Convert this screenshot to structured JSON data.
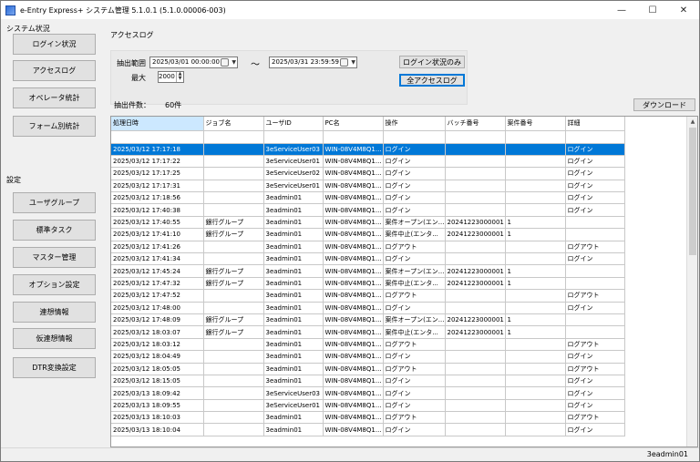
{
  "window": {
    "title": "e-Entry Express+ システム管理 5.1.0.1 (5.1.0.00006-003)",
    "controls": [
      "—",
      "☐",
      "✕"
    ]
  },
  "sidebar": {
    "system_status_label": "システム状況",
    "system_items": [
      {
        "label": "ログイン状況"
      },
      {
        "label": "アクセスログ"
      },
      {
        "label": "オペレータ統計"
      },
      {
        "label": "フォーム別統計"
      }
    ],
    "settings_label": "設定",
    "settings_items": [
      {
        "label": "ユーザグループ"
      },
      {
        "label": "標準タスク"
      },
      {
        "label": "マスター管理"
      },
      {
        "label": "オプション設定"
      },
      {
        "label": "連想情報"
      },
      {
        "label": "仮連想情報"
      },
      {
        "label": "DTR変換設定"
      }
    ]
  },
  "main": {
    "group_label": "アクセスログ",
    "filter": {
      "range_label": "抽出範囲",
      "from": "2025/03/01 00:00:00",
      "tilde": "～",
      "to": "2025/03/31 23:59:59",
      "max_label": "最大",
      "max_value": "2000",
      "login_only_button": "ログイン状況のみ",
      "all_logs_button": "全アクセスログ"
    },
    "count_label": "抽出件数：",
    "count_value": "60件",
    "download_button": "ダウンロード",
    "table": {
      "columns": [
        "処理日時",
        "ジョブ名",
        "ユーザID",
        "PC名",
        "操作",
        "バッチ番号",
        "案件番号",
        "詳細"
      ],
      "rows": [
        [
          "2025/03/12 17:17:18",
          "",
          "3eServiceUser03",
          "WIN-08V4M8Q1...",
          "ログイン",
          "",
          "",
          "ログイン"
        ],
        [
          "2025/03/12 17:17:22",
          "",
          "3eServiceUser01",
          "WIN-08V4M8Q1...",
          "ログイン",
          "",
          "",
          "ログイン"
        ],
        [
          "2025/03/12 17:17:25",
          "",
          "3eServiceUser02",
          "WIN-08V4M8Q1...",
          "ログイン",
          "",
          "",
          "ログイン"
        ],
        [
          "2025/03/12 17:17:31",
          "",
          "3eServiceUser01",
          "WIN-08V4M8Q1...",
          "ログイン",
          "",
          "",
          "ログイン"
        ],
        [
          "2025/03/12 17:18:56",
          "",
          "3eadmin01",
          "WIN-08V4M8Q1...",
          "ログイン",
          "",
          "",
          "ログイン"
        ],
        [
          "2025/03/12 17:40:38",
          "",
          "3eadmin01",
          "WIN-08V4M8Q1...",
          "ログイン",
          "",
          "",
          "ログイン"
        ],
        [
          "2025/03/12 17:40:55",
          "銀行グループ",
          "3eadmin01",
          "WIN-08V4M8Q1...",
          "案件オープン(エン...",
          "20241223000001",
          "1",
          ""
        ],
        [
          "2025/03/12 17:41:10",
          "銀行グループ",
          "3eadmin01",
          "WIN-08V4M8Q1...",
          "案件中止(エンタ...",
          "20241223000001",
          "1",
          ""
        ],
        [
          "2025/03/12 17:41:26",
          "",
          "3eadmin01",
          "WIN-08V4M8Q1...",
          "ログアウト",
          "",
          "",
          "ログアウト"
        ],
        [
          "2025/03/12 17:41:34",
          "",
          "3eadmin01",
          "WIN-08V4M8Q1...",
          "ログイン",
          "",
          "",
          "ログイン"
        ],
        [
          "2025/03/12 17:45:24",
          "銀行グループ",
          "3eadmin01",
          "WIN-08V4M8Q1...",
          "案件オープン(エン...",
          "20241223000001",
          "1",
          ""
        ],
        [
          "2025/03/12 17:47:32",
          "銀行グループ",
          "3eadmin01",
          "WIN-08V4M8Q1...",
          "案件中止(エンタ...",
          "20241223000001",
          "1",
          ""
        ],
        [
          "2025/03/12 17:47:52",
          "",
          "3eadmin01",
          "WIN-08V4M8Q1...",
          "ログアウト",
          "",
          "",
          "ログアウト"
        ],
        [
          "2025/03/12 17:48:00",
          "",
          "3eadmin01",
          "WIN-08V4M8Q1...",
          "ログイン",
          "",
          "",
          "ログイン"
        ],
        [
          "2025/03/12 17:48:09",
          "銀行グループ",
          "3eadmin01",
          "WIN-08V4M8Q1...",
          "案件オープン(エン...",
          "20241223000001",
          "1",
          ""
        ],
        [
          "2025/03/12 18:03:07",
          "銀行グループ",
          "3eadmin01",
          "WIN-08V4M8Q1...",
          "案件中止(エンタ...",
          "20241223000001",
          "1",
          ""
        ],
        [
          "2025/03/12 18:03:12",
          "",
          "3eadmin01",
          "WIN-08V4M8Q1...",
          "ログアウト",
          "",
          "",
          "ログアウト"
        ],
        [
          "2025/03/12 18:04:49",
          "",
          "3eadmin01",
          "WIN-08V4M8Q1...",
          "ログイン",
          "",
          "",
          "ログイン"
        ],
        [
          "2025/03/12 18:05:05",
          "",
          "3eadmin01",
          "WIN-08V4M8Q1...",
          "ログアウト",
          "",
          "",
          "ログアウト"
        ],
        [
          "2025/03/12 18:15:05",
          "",
          "3eadmin01",
          "WIN-08V4M8Q1...",
          "ログイン",
          "",
          "",
          "ログイン"
        ],
        [
          "2025/03/13 18:09:42",
          "",
          "3eServiceUser03",
          "WIN-08V4M8Q1...",
          "ログイン",
          "",
          "",
          "ログイン"
        ],
        [
          "2025/03/13 18:09:55",
          "",
          "3eServiceUser01",
          "WIN-08V4M8Q1...",
          "ログイン",
          "",
          "",
          "ログイン"
        ],
        [
          "2025/03/13 18:10:03",
          "",
          "3eadmin01",
          "WIN-08V4M8Q1...",
          "ログアウト",
          "",
          "",
          "ログアウト"
        ],
        [
          "2025/03/13 18:10:04",
          "",
          "3eadmin01",
          "WIN-08V4M8Q1...",
          "ログイン",
          "",
          "",
          "ログイン"
        ]
      ]
    }
  },
  "status": {
    "user": "3eadmin01"
  },
  "colors": {
    "selection": "#0078d7",
    "header_highlight": "#cce8ff"
  }
}
